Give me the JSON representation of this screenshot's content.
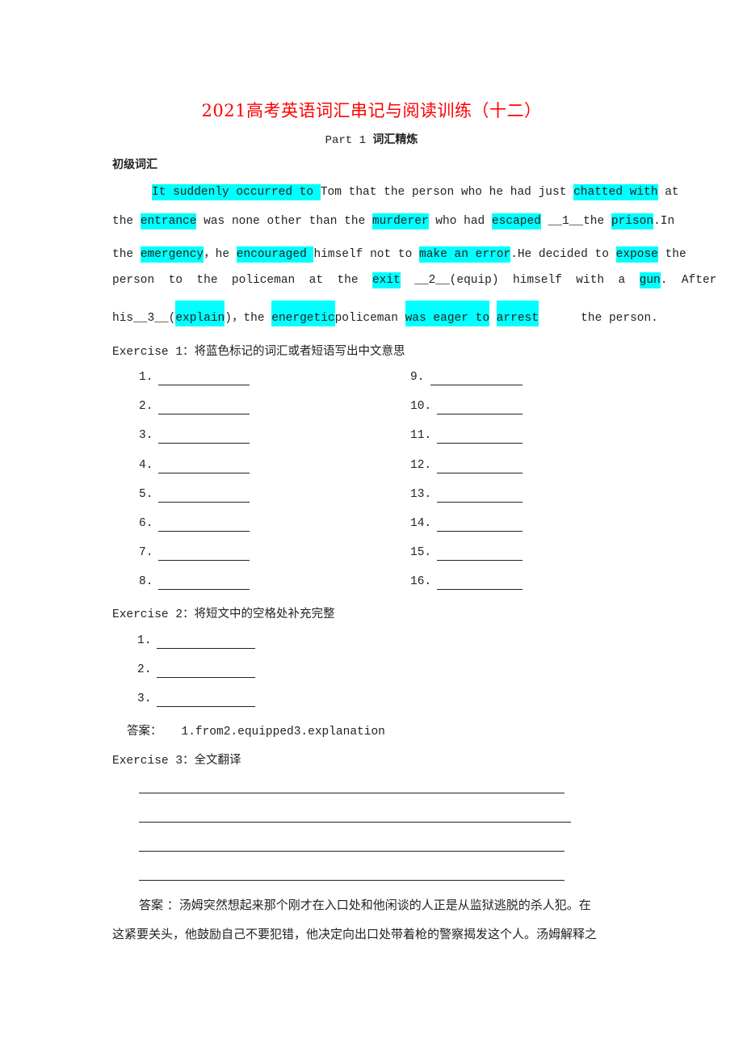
{
  "title": "2021高考英语词汇串记与阅读训练（十二）",
  "title_color": "#ff0000",
  "highlight_color": "#00ffff",
  "subtitle": {
    "part": "Part 1 ",
    "label": "词汇精炼"
  },
  "level_heading": "初级词汇",
  "passage": {
    "line1": {
      "hl1": "It suddenly occurred to ",
      "t1": "Tom that the person who he had just ",
      "hl2": "chatted with",
      "t2": " at"
    },
    "line2": {
      "t1": "the ",
      "hl1": "entrance",
      "t2": " was none other than the ",
      "hl2": "murderer",
      "t3": " who had ",
      "hl3": "escaped",
      "t4": " __1__the ",
      "hl4": "prison",
      "t5": ".In"
    },
    "line3": {
      "t1": "the ",
      "hl1": "emergency",
      "t2": "，he ",
      "hl2": "encouraged ",
      "t3": "himself not to ",
      "hl3": "make an error",
      "t4": ".He decided to ",
      "hl4": "expose",
      "t5": " the"
    },
    "line4": {
      "t1": "person  to  the  policeman  at  the  ",
      "hl1": "exit",
      "t2": "  __2__(equip)  himself  with  a  ",
      "hl2": "gun",
      "t3": ".  After"
    },
    "line5": {
      "t1": "his__3__(",
      "hl1": "explain",
      "t2": ")，the ",
      "hl2": "energetic ",
      "t3": "policeman ",
      "hl3": "was eager to",
      "t4": " ",
      "hl4": "arrest",
      "t5": "      the person."
    }
  },
  "exercise1": {
    "title_en": "Exercise 1：",
    "title_cn": "将蓝色标记的词汇或者短语写出中文意思",
    "left_items": [
      "1.",
      "2.",
      "3.",
      "4.",
      "5.",
      "6.",
      "7.",
      "8."
    ],
    "right_items": [
      "9.",
      "10.",
      "11.",
      "12.",
      "13.",
      "14.",
      "15.",
      "16."
    ]
  },
  "exercise2": {
    "title_en": "Exercise 2：",
    "title_cn": "将短文中的空格处补充完整",
    "items": [
      "1.",
      "2.",
      "3."
    ],
    "answer_label": "答案：",
    "answer_text": "1.from2.equipped3.explanation"
  },
  "exercise3": {
    "title_en": "Exercise 3：",
    "title_cn": "全文翻译",
    "answer_label": "答案  ：",
    "answer_line1": "汤姆突然想起来那个刚才在入口处和他闲谈的人正是从监狱逃脱的杀人犯。在",
    "answer_line2": "这紧要关头，他鼓励自己不要犯错，他决定向出口处带着枪的警察揭发这个人。汤姆解释之"
  }
}
